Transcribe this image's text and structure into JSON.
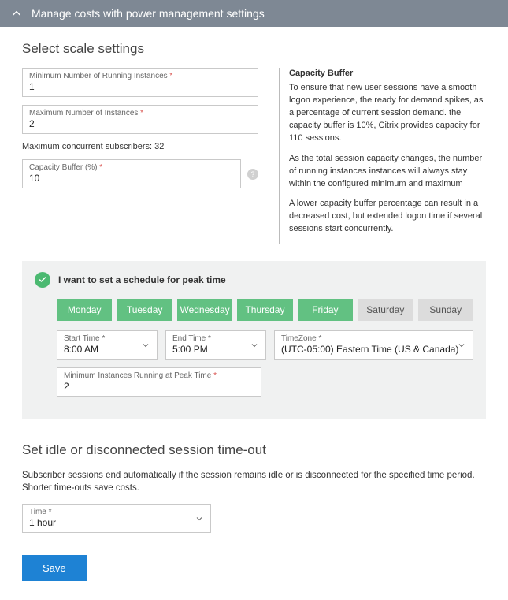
{
  "header": {
    "title": "Manage costs with power management settings"
  },
  "scale": {
    "heading": "Select scale settings",
    "min_instances": {
      "label": "Minimum Number of Running Instances",
      "value": "1"
    },
    "max_instances": {
      "label": "Maximum Number of Instances",
      "value": "2"
    },
    "max_subs_label": "Maximum concurrent subscribers: 32",
    "capacity": {
      "label": "Capacity Buffer (%)",
      "value": "10"
    }
  },
  "buffer_help": {
    "title": "Capacity Buffer",
    "p1": "To ensure that new user sessions have a smooth logon experience, the ready for demand spikes, as a percentage of current session demand. the capacity buffer is 10%, Citrix provides capacity for 110 sessions.",
    "p2": "As the total session capacity changes, the number of running instances instances will always stay within the configured minimum and maximum",
    "p3": "A lower capacity buffer percentage can result in a decreased cost, but extended logon time if several sessions start concurrently."
  },
  "schedule": {
    "toggle_label": "I want to set a schedule for peak time",
    "days": [
      {
        "label": "Monday",
        "on": true
      },
      {
        "label": "Tuesday",
        "on": true
      },
      {
        "label": "Wednesday",
        "on": true
      },
      {
        "label": "Thursday",
        "on": true
      },
      {
        "label": "Friday",
        "on": true
      },
      {
        "label": "Saturday",
        "on": false
      },
      {
        "label": "Sunday",
        "on": false
      }
    ],
    "start": {
      "label": "Start Time",
      "value": "8:00 AM"
    },
    "end": {
      "label": "End Time",
      "value": "5:00 PM"
    },
    "tz": {
      "label": "TimeZone",
      "value": "(UTC-05:00) Eastern Time (US & Canada)"
    },
    "min_peak": {
      "label": "Minimum Instances Running at Peak Time",
      "value": "2"
    }
  },
  "idle": {
    "heading": "Set idle or disconnected session time-out",
    "desc": "Subscriber sessions end automatically if the session remains idle or is disconnected for the specified time period. Shorter time-outs save costs.",
    "time": {
      "label": "Time",
      "value": "1 hour"
    }
  },
  "save_label": "Save",
  "required_mark": "*"
}
